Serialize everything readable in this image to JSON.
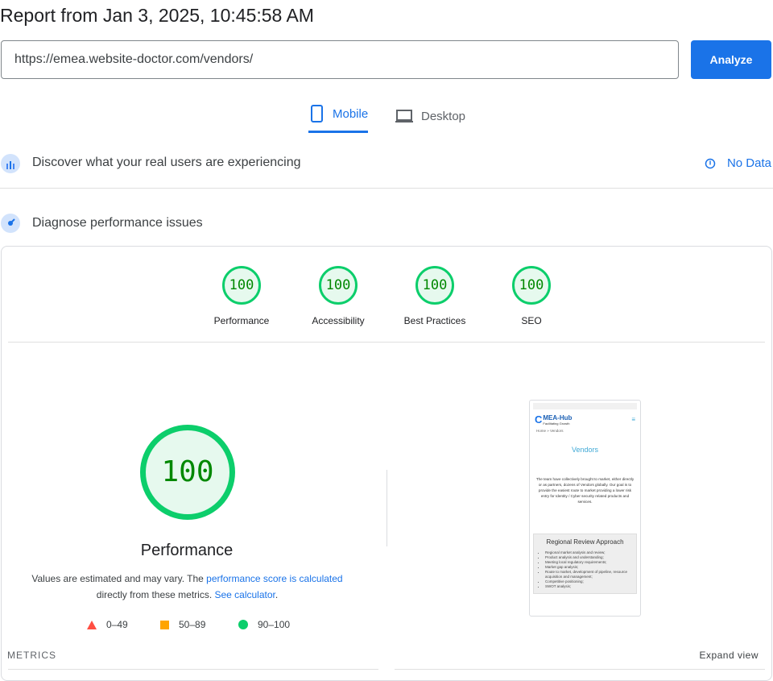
{
  "report_title": "Report from Jan 3, 2025, 10:45:58 AM",
  "url_value": "https://emea.website-doctor.com/vendors/",
  "analyze_label": "Analyze",
  "tabs": [
    {
      "label": "Mobile",
      "active": true
    },
    {
      "label": "Desktop",
      "active": false
    }
  ],
  "field_section": {
    "title": "Discover what your real users are experiencing",
    "status": "No Data"
  },
  "lab_section": {
    "title": "Diagnose performance issues"
  },
  "scores": [
    {
      "label": "Performance",
      "value": "100"
    },
    {
      "label": "Accessibility",
      "value": "100"
    },
    {
      "label": "Best Practices",
      "value": "100"
    },
    {
      "label": "SEO",
      "value": "100"
    }
  ],
  "main_score": {
    "value": "100",
    "label": "Performance",
    "desc_prefix": "Values are estimated and may vary. The ",
    "desc_link1": "performance score is calculated",
    "desc_mid": " directly from these metrics. ",
    "desc_link2": "See calculator",
    "desc_suffix": "."
  },
  "legend": [
    {
      "range": "0–49",
      "color": "#ff4e42"
    },
    {
      "range": "50–89",
      "color": "#ffa400"
    },
    {
      "range": "90–100",
      "color": "#0cce6b"
    }
  ],
  "thumbnail": {
    "logo": "MEA-Hub",
    "tagline": "Facilitating Growth",
    "breadcrumb": "Home » Vendors",
    "heading": "Vendors",
    "body": "The team have collectively brought to market, either directly or as partners, dozens of Vendors globally. Our goal is to provide the easiest route to market providing a lower risk entry for Identity / Cyber security related products and services.",
    "box_title": "Regional Review Approach",
    "items": [
      "Regional market analysis and review;",
      "Product analysis and understanding;",
      "Meeting local regulatory requirements;",
      "Market gap analysis;",
      "Route to market, development of pipeline, resource acquisition and management;",
      "Competitive positioning;",
      "SWOT analysis;"
    ]
  },
  "metrics_label": "METRICS",
  "expand_label": "Expand view",
  "colors": {
    "accent": "#1a73e8",
    "pass": "#0cce6b"
  }
}
